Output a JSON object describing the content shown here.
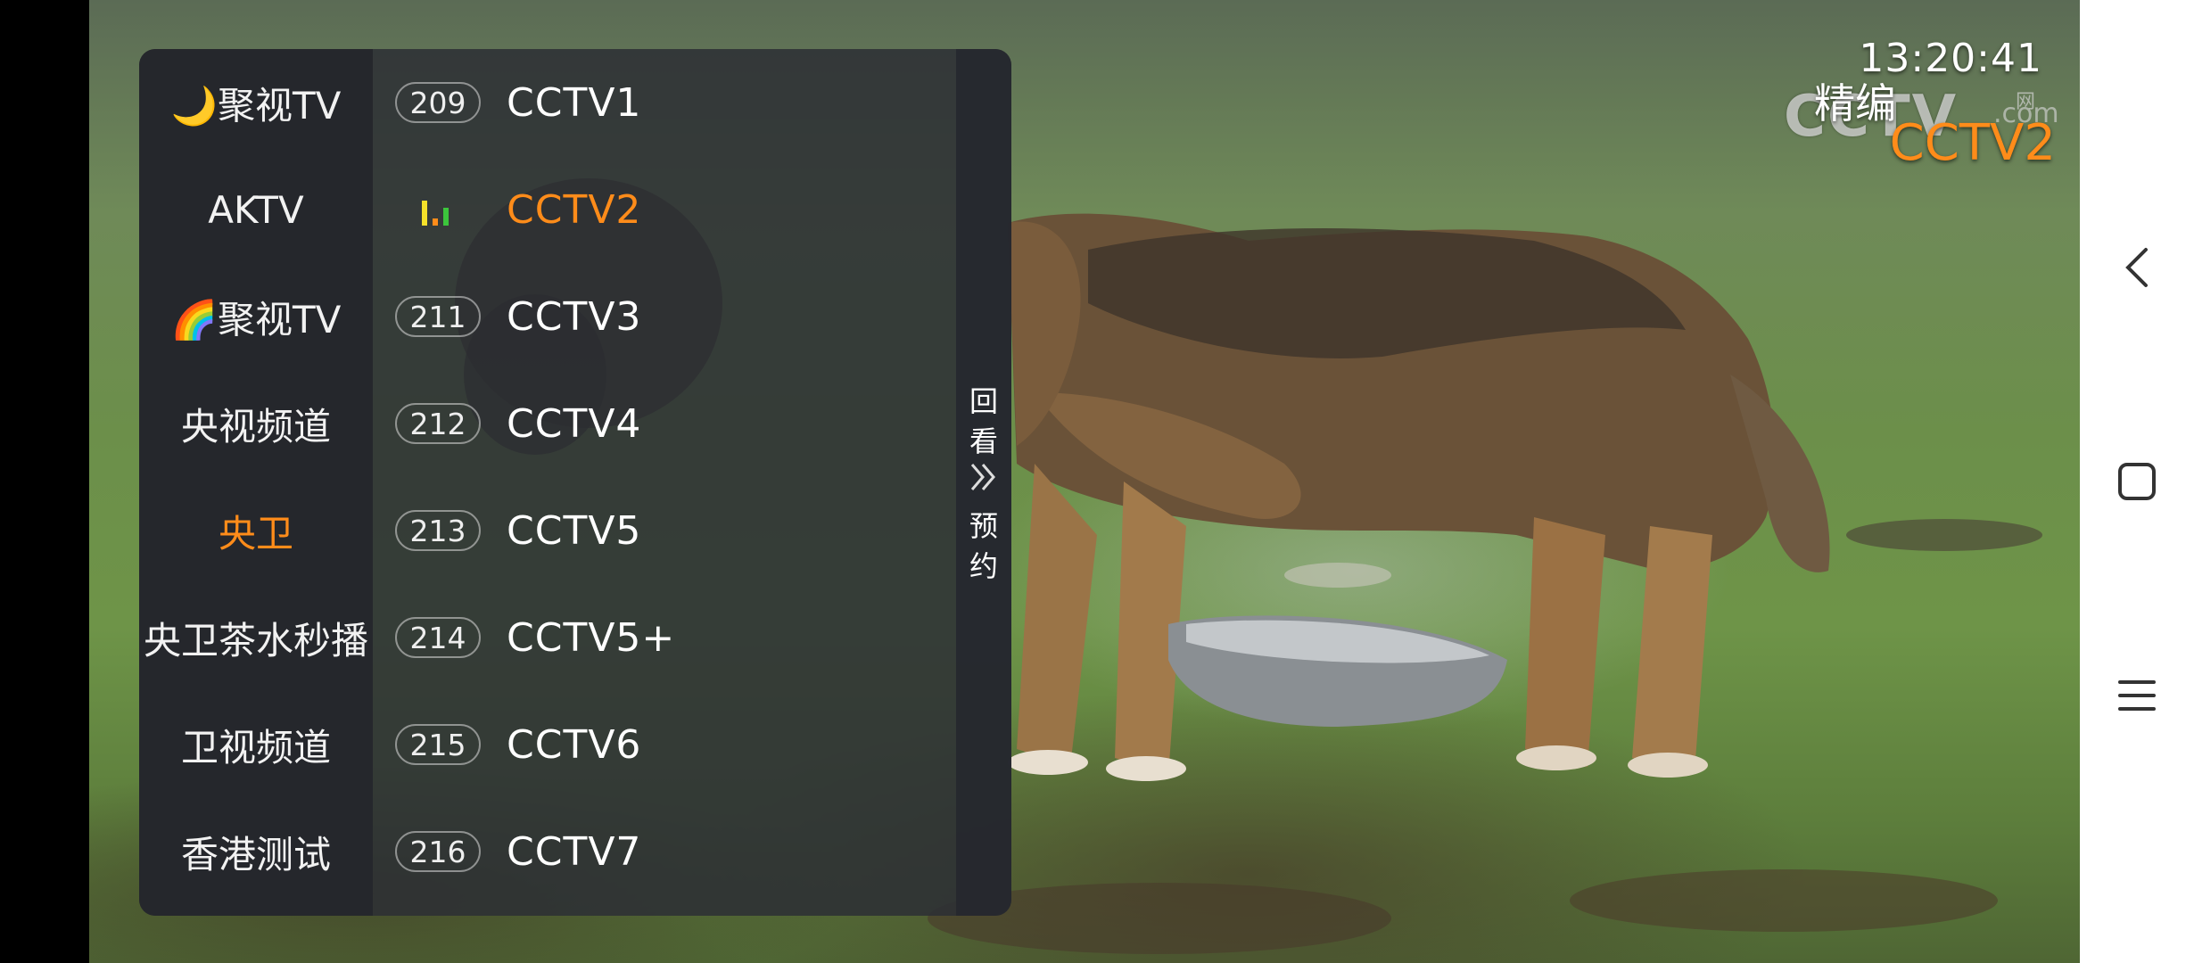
{
  "overlay": {
    "clock": "13:20:41",
    "program_label": "精编",
    "current_channel": "CCTV2",
    "logo_text": "CCTV",
    "logo_suffix": ".com",
    "logo_net": "网"
  },
  "groups": [
    {
      "label": "🌙聚视TV",
      "active": false
    },
    {
      "label": "AKTV",
      "active": false
    },
    {
      "label": "🌈聚视TV",
      "active": false
    },
    {
      "label": "央视频道",
      "active": false
    },
    {
      "label": "央卫",
      "active": true
    },
    {
      "label": "央卫茶水秒播",
      "active": false
    },
    {
      "label": "卫视频道",
      "active": false
    },
    {
      "label": "香港测试",
      "active": false
    }
  ],
  "channels": [
    {
      "number": "209",
      "name": "CCTV1",
      "active": false
    },
    {
      "number": "",
      "name": "CCTV2",
      "active": true
    },
    {
      "number": "211",
      "name": "CCTV3",
      "active": false
    },
    {
      "number": "212",
      "name": "CCTV4",
      "active": false
    },
    {
      "number": "213",
      "name": "CCTV5",
      "active": false
    },
    {
      "number": "214",
      "name": "CCTV5+",
      "active": false
    },
    {
      "number": "215",
      "name": "CCTV6",
      "active": false
    },
    {
      "number": "216",
      "name": "CCTV7",
      "active": false
    }
  ],
  "side_tab": {
    "top_chars": [
      "回",
      "看"
    ],
    "bottom_chars": [
      "预",
      "约"
    ],
    "arrow_icon": "double-chevron-right-icon"
  },
  "playing_indicator": {
    "icon": "equalizer-icon",
    "colors": [
      "#f5e12a",
      "#ff8c1a",
      "#3cc63c"
    ]
  },
  "nav": {
    "back_icon": "back-chevron-icon",
    "home_icon": "home-square-icon",
    "recents_icon": "menu-lines-icon"
  },
  "colors": {
    "accent": "#ff8c1a",
    "panel_bg": "#2c2e34",
    "text": "#ffffff"
  }
}
